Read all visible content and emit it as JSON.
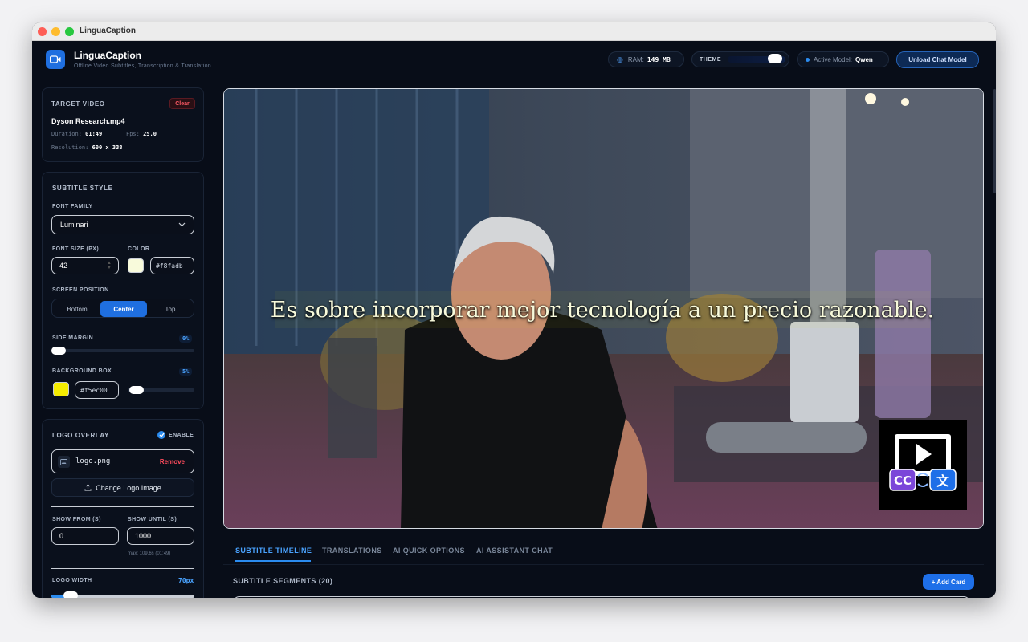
{
  "window": {
    "title": "LinguaCaption"
  },
  "header": {
    "app_name": "LinguaCaption",
    "app_subtitle": "Offline Video Subtitles, Transcription & Translation",
    "ram_label": "RAM:",
    "ram_value": "149 MB",
    "theme_label": "THEME",
    "model_label": "Active Model:",
    "model_value": "Qwen",
    "unload_button": "Unload Chat Model"
  },
  "target_video": {
    "title": "TARGET VIDEO",
    "clear": "Clear",
    "filename": "Dyson Research.mp4",
    "duration_label": "Duration:",
    "duration": "01:49",
    "fps_label": "Fps:",
    "fps": "25.0",
    "resolution_label": "Resolution:",
    "resolution": "600 x 338"
  },
  "subtitle_style": {
    "title": "SUBTITLE STYLE",
    "font_family_label": "FONT FAMILY",
    "font_family": "Luminari",
    "font_size_label": "FONT SIZE (PX)",
    "font_size": "42",
    "color_label": "COLOR",
    "color_value": "#f8fadb",
    "position_label": "SCREEN POSITION",
    "positions": [
      "Bottom",
      "Center",
      "Top"
    ],
    "selected_position": "Center",
    "side_margin_label": "SIDE MARGIN",
    "side_margin_value": "0%",
    "side_margin": 0,
    "bg_box_label": "BACKGROUND BOX",
    "bg_box_value": "5%",
    "bg_box": 0.05,
    "bg_color": "#f5ec00"
  },
  "logo_overlay": {
    "title": "LOGO OVERLAY",
    "enable_label": "ENABLE",
    "enabled": true,
    "filename": "logo.png",
    "remove": "Remove",
    "change_button": "Change Logo Image",
    "show_from_label": "SHOW FROM (S)",
    "show_from": "0",
    "show_until_label": "SHOW UNTIL (S)",
    "show_until": "1000",
    "max_hint": "max: 109.6s (01:49)",
    "width_label": "LOGO WIDTH",
    "width_value": "70px"
  },
  "video": {
    "subtitle_text": "Es sobre incorporar mejor tecnología a un precio razonable."
  },
  "tabs": [
    "SUBTITLE TIMELINE",
    "TRANSLATIONS",
    "AI QUICK OPTIONS",
    "AI ASSISTANT CHAT"
  ],
  "timeline": {
    "segments_label": "SUBTITLE SEGMENTS (20)",
    "add_card": "+ Add Card"
  },
  "colors": {
    "accent": "#1f6fe0",
    "danger": "#ff5a66",
    "background": "#080d18"
  }
}
